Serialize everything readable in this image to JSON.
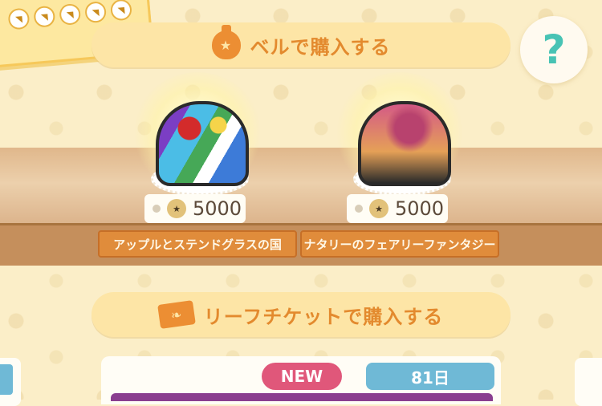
{
  "header_bells": {
    "label": "ベルで購入する",
    "icon": "bell-bag-icon"
  },
  "header_leaf": {
    "label": "リーフチケットで購入する",
    "icon": "leaf-ticket-icon"
  },
  "help": {
    "label": "?"
  },
  "items": [
    {
      "name": "アップルとステンドグラスの国",
      "price": "5000",
      "price_icon": "bell-bag-icon"
    },
    {
      "name": "ナタリーのフェアリーファンタジー",
      "price": "5000",
      "price_icon": "bell-bag-icon"
    }
  ],
  "bottom": {
    "new_badge": "NEW",
    "days": "81日"
  },
  "colors": {
    "accent_orange": "#e38a2e",
    "teal": "#48c3b4",
    "new_pink": "#e0577a",
    "days_blue": "#6fb9d6"
  }
}
